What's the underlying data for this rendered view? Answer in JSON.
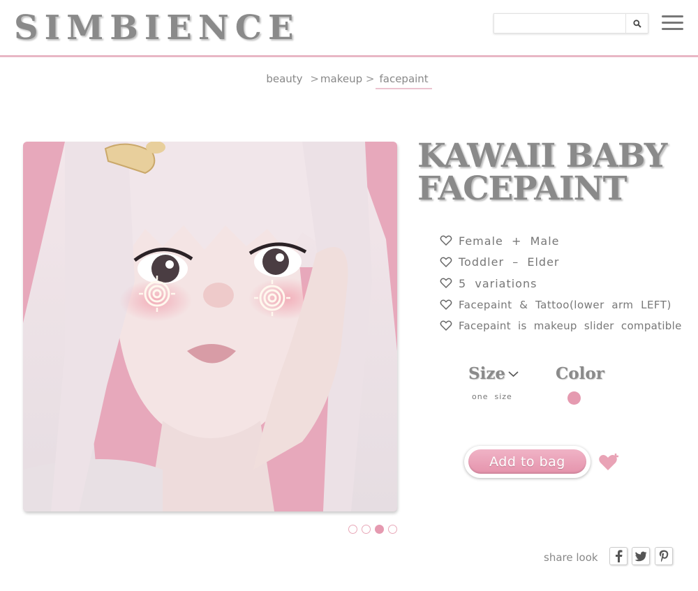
{
  "brand": {
    "logo_text": "SIMBIENCE"
  },
  "search": {
    "placeholder": "",
    "value": "",
    "icon": "search-icon"
  },
  "menu": {
    "icon": "hamburger-menu-icon"
  },
  "breadcrumb": {
    "items": [
      "beauty",
      "makeup",
      "facepaint"
    ],
    "separator": ">"
  },
  "product": {
    "title_line1": "KAWAII BABY",
    "title_line2": "FACEPAINT",
    "features": [
      "Female  +  Male",
      "Toddler  –  Elder",
      "5  variations",
      "Facepaint  &  Tattoo(lower  arm  LEFT)",
      "Facepaint  is  makeup  slider  compatible"
    ],
    "size_label": "Size",
    "size_value": "one  size",
    "color_label": "Color",
    "color_swatch": "#e59ab0",
    "add_to_bag_label": "Add to bag",
    "wishlist_icon": "heart-plus-icon"
  },
  "gallery": {
    "slide_count": 4,
    "active_slide": 3
  },
  "share": {
    "label": "share look",
    "buttons": [
      "facebook-icon",
      "twitter-icon",
      "pinterest-icon"
    ]
  },
  "colors": {
    "accent_pink": "#e59ab0",
    "header_border": "#e8b7c5",
    "logo_gray": "#8a8a8a"
  }
}
